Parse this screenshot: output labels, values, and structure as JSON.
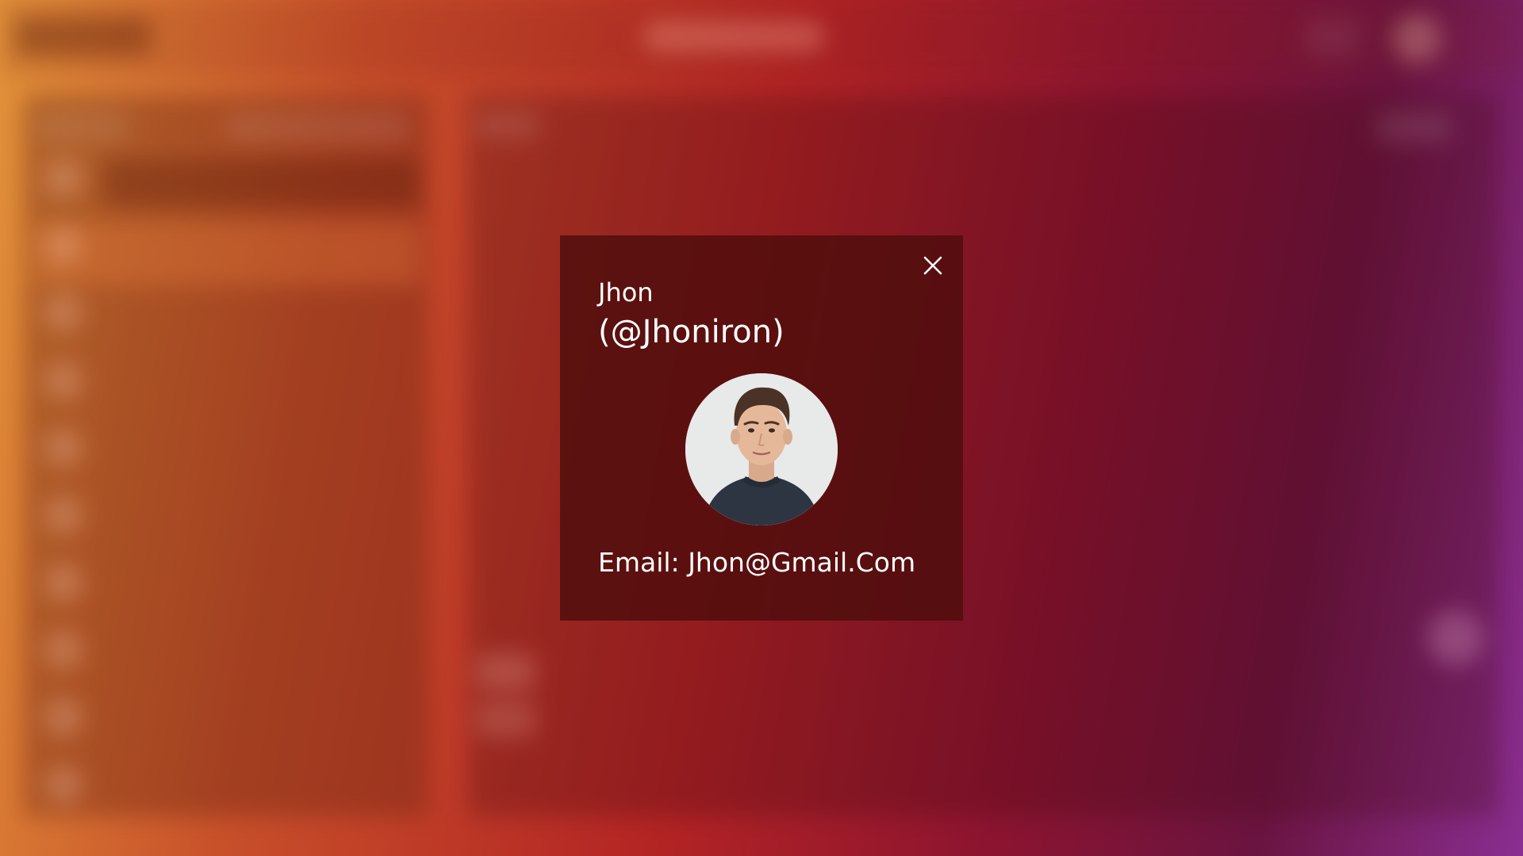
{
  "profile_modal": {
    "name": "Jhon",
    "handle": "(@Jhoniron)",
    "email_label": "Email:",
    "email_value": "Jhon@Gmail.Com",
    "close_icon": "close-icon",
    "avatar_alt": "profile photo"
  },
  "colors": {
    "modal_background": "#4e0e0c",
    "text": "#ffffff"
  }
}
